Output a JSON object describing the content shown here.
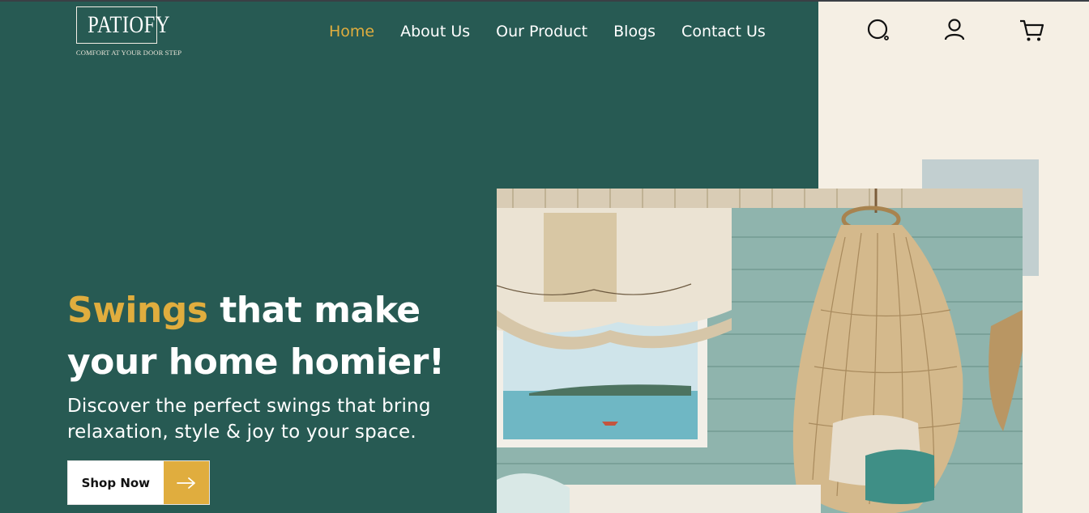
{
  "brand": {
    "name": "PATIOFY",
    "tagline": "COMFORT AT YOUR DOOR STEP"
  },
  "nav": {
    "items": [
      {
        "label": "Home",
        "active": true
      },
      {
        "label": "About Us",
        "active": false
      },
      {
        "label": "Our Product",
        "active": false
      },
      {
        "label": "Blogs",
        "active": false
      },
      {
        "label": "Contact Us",
        "active": false
      }
    ]
  },
  "header_icons": [
    "search-icon",
    "user-icon",
    "cart-icon"
  ],
  "hero": {
    "title_accent": "Swings",
    "title_rest_line1": " that make",
    "title_line2": "your home homier!",
    "subtitle_line1": "Discover the perfect swings that bring",
    "subtitle_line2": "relaxation, style & joy to your space.",
    "cta_label": "Shop Now",
    "image_alt": "hanging-swing-chair-room"
  },
  "colors": {
    "primary": "#275a53",
    "accent": "#e0ad3e",
    "cream": "#f5efe4",
    "deco": "#c2cfd0"
  }
}
